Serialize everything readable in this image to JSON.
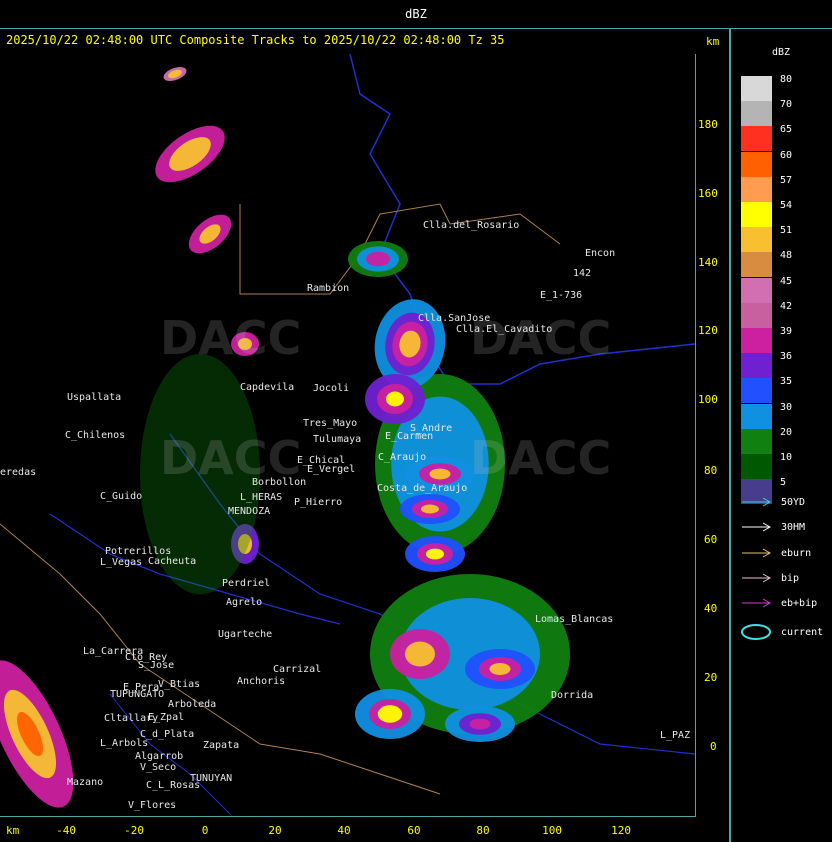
{
  "window": {
    "title": "dBZ"
  },
  "header": {
    "status": "2025/10/22 02:48:00 UTC Composite Tracks to 2025/10/22 02:48:00 Tz 35",
    "km_label": "km"
  },
  "axes": {
    "x_unit": "km",
    "y_unit": "km",
    "x_ticks": [
      "-40",
      "-20",
      "0",
      "20",
      "40",
      "60",
      "80",
      "100",
      "120"
    ],
    "y_ticks": [
      "180",
      "160",
      "140",
      "120",
      "100",
      "80",
      "60",
      "40",
      "20",
      "0"
    ]
  },
  "legend": {
    "title": "dBZ",
    "levels": [
      {
        "label": "80",
        "color": "#d8d8d8"
      },
      {
        "label": "70",
        "color": "#b4b4b4"
      },
      {
        "label": "65",
        "color": "#ff3020"
      },
      {
        "label": "60",
        "color": "#ff6000"
      },
      {
        "label": "57",
        "color": "#ff9c50"
      },
      {
        "label": "54",
        "color": "#ffff00"
      },
      {
        "label": "51",
        "color": "#f8c030"
      },
      {
        "label": "48",
        "color": "#d88c40"
      },
      {
        "label": "45",
        "color": "#d070b0"
      },
      {
        "label": "42",
        "color": "#c860a0"
      },
      {
        "label": "39",
        "color": "#cc20a0"
      },
      {
        "label": "36",
        "color": "#7020d0"
      },
      {
        "label": "35",
        "color": "#2050ff"
      },
      {
        "label": "30",
        "color": "#1090e0"
      },
      {
        "label": "20",
        "color": "#108010"
      },
      {
        "label": "10",
        "color": "#005800"
      },
      {
        "label": "5",
        "color": "#483c8c"
      }
    ]
  },
  "tracks": [
    {
      "label": "50YD",
      "color": "#40d0d0"
    },
    {
      "label": "30HM",
      "color": "#ffffff"
    },
    {
      "label": "eburn",
      "color": "#e8c070"
    },
    {
      "label": "bip",
      "color": "#f0c0d0"
    },
    {
      "label": "eb+bip",
      "color": "#d040d0"
    },
    {
      "label": "current",
      "color": "#40e0e0"
    }
  ],
  "places": [
    "Clla.del_Rosario",
    "Encon",
    "E_1-736",
    "Rambion",
    "Clla.SanJose",
    "Clla.El_Cavadito",
    "Uspallata",
    "C_Chilenos",
    "Tres_Mayo",
    "Tulumaya",
    "E_Chical",
    "E_Vergel",
    "Borbollon",
    "P_Hierro",
    "L_HERAS",
    "MENDOZA",
    "Potrerillos",
    "L_Vegas",
    "Perdriel",
    "Agrelo",
    "Ugarteche",
    "La_Carrera",
    "S_Jose",
    "TUPUNGATO",
    "E_Zpal",
    "L_Arbols",
    "Zapata",
    "TUNUYAN",
    "V_Flores",
    "Lomas_Blancas",
    "Dorrida",
    "L_PAZ",
    "C_Araujo",
    "Costa_de_Araujo",
    "S_Andre",
    "E_Carmen",
    "Capdevila",
    "Jocoli",
    "C_Guido",
    "Cacheuta",
    "Anchoris",
    "Carrizal",
    "Cto_Rey",
    "V_Btias",
    "E_Pera",
    "Arboleda",
    "Cltallary",
    "C_d_Plata",
    "Algarrob",
    "V_Seco",
    "C_L_Rosas",
    "Mazano",
    "eredas",
    "142"
  ]
}
